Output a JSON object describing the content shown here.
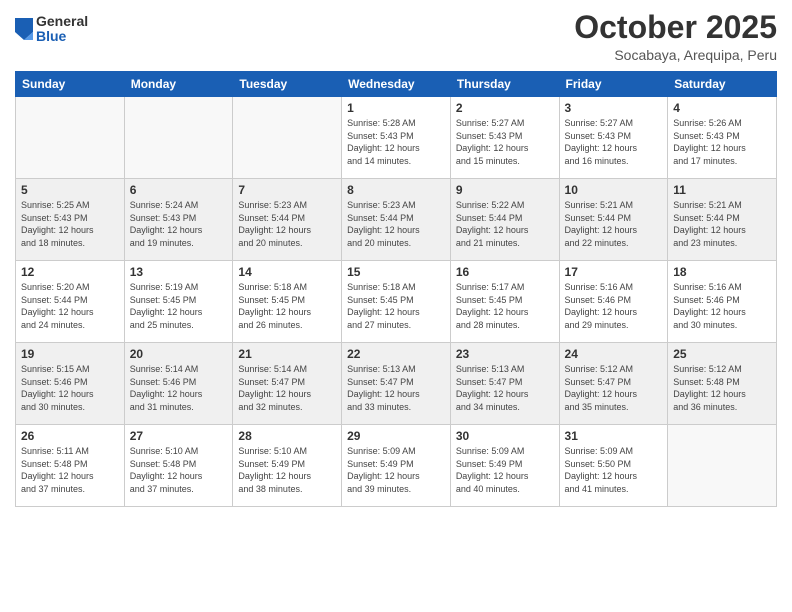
{
  "logo": {
    "general": "General",
    "blue": "Blue"
  },
  "header": {
    "month": "October 2025",
    "location": "Socabaya, Arequipa, Peru"
  },
  "weekdays": [
    "Sunday",
    "Monday",
    "Tuesday",
    "Wednesday",
    "Thursday",
    "Friday",
    "Saturday"
  ],
  "weeks": [
    [
      {
        "day": "",
        "info": ""
      },
      {
        "day": "",
        "info": ""
      },
      {
        "day": "",
        "info": ""
      },
      {
        "day": "1",
        "info": "Sunrise: 5:28 AM\nSunset: 5:43 PM\nDaylight: 12 hours\nand 14 minutes."
      },
      {
        "day": "2",
        "info": "Sunrise: 5:27 AM\nSunset: 5:43 PM\nDaylight: 12 hours\nand 15 minutes."
      },
      {
        "day": "3",
        "info": "Sunrise: 5:27 AM\nSunset: 5:43 PM\nDaylight: 12 hours\nand 16 minutes."
      },
      {
        "day": "4",
        "info": "Sunrise: 5:26 AM\nSunset: 5:43 PM\nDaylight: 12 hours\nand 17 minutes."
      }
    ],
    [
      {
        "day": "5",
        "info": "Sunrise: 5:25 AM\nSunset: 5:43 PM\nDaylight: 12 hours\nand 18 minutes."
      },
      {
        "day": "6",
        "info": "Sunrise: 5:24 AM\nSunset: 5:43 PM\nDaylight: 12 hours\nand 19 minutes."
      },
      {
        "day": "7",
        "info": "Sunrise: 5:23 AM\nSunset: 5:44 PM\nDaylight: 12 hours\nand 20 minutes."
      },
      {
        "day": "8",
        "info": "Sunrise: 5:23 AM\nSunset: 5:44 PM\nDaylight: 12 hours\nand 20 minutes."
      },
      {
        "day": "9",
        "info": "Sunrise: 5:22 AM\nSunset: 5:44 PM\nDaylight: 12 hours\nand 21 minutes."
      },
      {
        "day": "10",
        "info": "Sunrise: 5:21 AM\nSunset: 5:44 PM\nDaylight: 12 hours\nand 22 minutes."
      },
      {
        "day": "11",
        "info": "Sunrise: 5:21 AM\nSunset: 5:44 PM\nDaylight: 12 hours\nand 23 minutes."
      }
    ],
    [
      {
        "day": "12",
        "info": "Sunrise: 5:20 AM\nSunset: 5:44 PM\nDaylight: 12 hours\nand 24 minutes."
      },
      {
        "day": "13",
        "info": "Sunrise: 5:19 AM\nSunset: 5:45 PM\nDaylight: 12 hours\nand 25 minutes."
      },
      {
        "day": "14",
        "info": "Sunrise: 5:18 AM\nSunset: 5:45 PM\nDaylight: 12 hours\nand 26 minutes."
      },
      {
        "day": "15",
        "info": "Sunrise: 5:18 AM\nSunset: 5:45 PM\nDaylight: 12 hours\nand 27 minutes."
      },
      {
        "day": "16",
        "info": "Sunrise: 5:17 AM\nSunset: 5:45 PM\nDaylight: 12 hours\nand 28 minutes."
      },
      {
        "day": "17",
        "info": "Sunrise: 5:16 AM\nSunset: 5:46 PM\nDaylight: 12 hours\nand 29 minutes."
      },
      {
        "day": "18",
        "info": "Sunrise: 5:16 AM\nSunset: 5:46 PM\nDaylight: 12 hours\nand 30 minutes."
      }
    ],
    [
      {
        "day": "19",
        "info": "Sunrise: 5:15 AM\nSunset: 5:46 PM\nDaylight: 12 hours\nand 30 minutes."
      },
      {
        "day": "20",
        "info": "Sunrise: 5:14 AM\nSunset: 5:46 PM\nDaylight: 12 hours\nand 31 minutes."
      },
      {
        "day": "21",
        "info": "Sunrise: 5:14 AM\nSunset: 5:47 PM\nDaylight: 12 hours\nand 32 minutes."
      },
      {
        "day": "22",
        "info": "Sunrise: 5:13 AM\nSunset: 5:47 PM\nDaylight: 12 hours\nand 33 minutes."
      },
      {
        "day": "23",
        "info": "Sunrise: 5:13 AM\nSunset: 5:47 PM\nDaylight: 12 hours\nand 34 minutes."
      },
      {
        "day": "24",
        "info": "Sunrise: 5:12 AM\nSunset: 5:47 PM\nDaylight: 12 hours\nand 35 minutes."
      },
      {
        "day": "25",
        "info": "Sunrise: 5:12 AM\nSunset: 5:48 PM\nDaylight: 12 hours\nand 36 minutes."
      }
    ],
    [
      {
        "day": "26",
        "info": "Sunrise: 5:11 AM\nSunset: 5:48 PM\nDaylight: 12 hours\nand 37 minutes."
      },
      {
        "day": "27",
        "info": "Sunrise: 5:10 AM\nSunset: 5:48 PM\nDaylight: 12 hours\nand 37 minutes."
      },
      {
        "day": "28",
        "info": "Sunrise: 5:10 AM\nSunset: 5:49 PM\nDaylight: 12 hours\nand 38 minutes."
      },
      {
        "day": "29",
        "info": "Sunrise: 5:09 AM\nSunset: 5:49 PM\nDaylight: 12 hours\nand 39 minutes."
      },
      {
        "day": "30",
        "info": "Sunrise: 5:09 AM\nSunset: 5:49 PM\nDaylight: 12 hours\nand 40 minutes."
      },
      {
        "day": "31",
        "info": "Sunrise: 5:09 AM\nSunset: 5:50 PM\nDaylight: 12 hours\nand 41 minutes."
      },
      {
        "day": "",
        "info": ""
      }
    ]
  ]
}
